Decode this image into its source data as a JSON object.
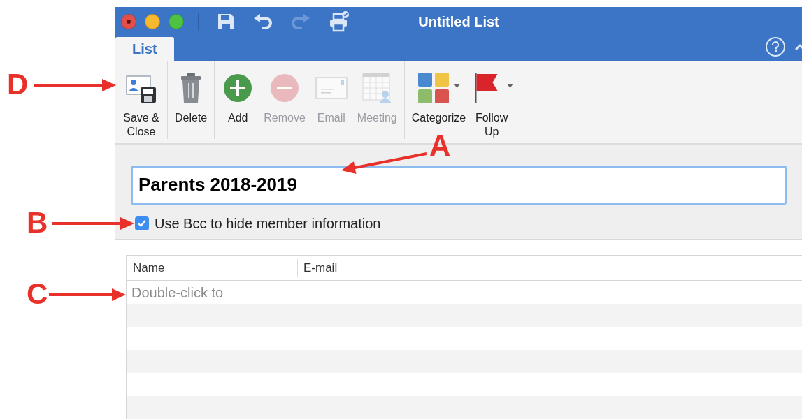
{
  "window": {
    "title": "Untitled List"
  },
  "tabs": [
    {
      "label": "List",
      "selected": true
    }
  ],
  "toolbar": {
    "groups": [
      [
        {
          "kind": "save_close",
          "label": "Save & Close",
          "disabled": false,
          "dropdown": false
        }
      ],
      [
        {
          "kind": "delete",
          "label": "Delete",
          "disabled": false,
          "dropdown": false
        }
      ],
      [
        {
          "kind": "add",
          "label": "Add",
          "disabled": false,
          "dropdown": false
        },
        {
          "kind": "remove",
          "label": "Remove",
          "disabled": true,
          "dropdown": false
        },
        {
          "kind": "email",
          "label": "Email",
          "disabled": true,
          "dropdown": false
        },
        {
          "kind": "meeting",
          "label": "Meeting",
          "disabled": true,
          "dropdown": false
        }
      ],
      [
        {
          "kind": "categorize",
          "label": "Categorize",
          "disabled": false,
          "dropdown": true
        },
        {
          "kind": "follow_up",
          "label": "Follow Up",
          "disabled": false,
          "dropdown": true
        }
      ]
    ]
  },
  "list_name": {
    "value": "Parents 2018-2019",
    "focused": true
  },
  "bcc_option": {
    "label": "Use Bcc to hide member information",
    "checked": true
  },
  "table": {
    "columns": [
      "Name",
      "E-mail"
    ],
    "hint": "Double-click to"
  },
  "annotations": [
    {
      "letter": "D"
    },
    {
      "letter": "A"
    },
    {
      "letter": "B"
    },
    {
      "letter": "C"
    }
  ]
}
